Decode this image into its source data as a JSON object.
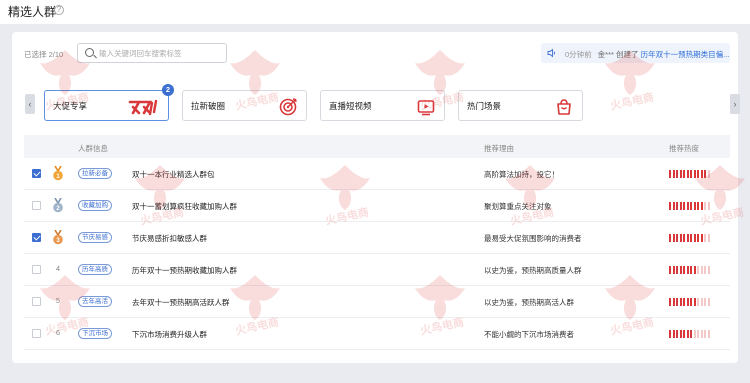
{
  "topbar": {
    "title": "精选人群",
    "help_icon": "help-circle-icon"
  },
  "toolbar": {
    "selected_label": "已选择",
    "selected_value": "2/10",
    "search_placeholder": "输入关键词回车搜索标签"
  },
  "notice": {
    "speaker_icon": "speaker-icon",
    "time": "0分钟前",
    "user_text": "金*** 创建了",
    "link_text": "历年双十一预热期类目偏..."
  },
  "tabs": [
    {
      "label": "大促专享",
      "icon": "double11-logo",
      "badge": "2",
      "active": true
    },
    {
      "label": "拉新破圈",
      "icon": "target-icon",
      "badge": "",
      "active": false
    },
    {
      "label": "直播短视频",
      "icon": "play-screen-icon",
      "badge": "",
      "active": false
    },
    {
      "label": "热门场景",
      "icon": "shopping-bag-icon",
      "badge": "",
      "active": false
    }
  ],
  "table": {
    "columns": {
      "info": "人群信息",
      "reason": "推荐理由",
      "heat": "推荐热度"
    },
    "rows": [
      {
        "checked": true,
        "rank": "1",
        "medal": "gold",
        "tag": "拉新必备",
        "name": "双十一本行业精选人群包",
        "reason": "高阶算法加持，投它！",
        "heat": 0.95
      },
      {
        "checked": false,
        "rank": "2",
        "medal": "silver",
        "tag": "收藏加购",
        "name": "双十一蓄划算疯狂收藏加购人群",
        "reason": "聚划算重点关注对象",
        "heat": 0.85
      },
      {
        "checked": true,
        "rank": "3",
        "medal": "bronze",
        "tag": "节庆易感",
        "name": "节庆易感折扣敏感人群",
        "reason": "最易受大促氛围影响的消费者",
        "heat": 0.8
      },
      {
        "checked": false,
        "rank": "4",
        "medal": "",
        "tag": "历年高质",
        "name": "历年双十一预热期收藏加购人群",
        "reason": "以史为鉴，预热期高质量人群",
        "heat": 0.7
      },
      {
        "checked": false,
        "rank": "5",
        "medal": "",
        "tag": "去年高活",
        "name": "去年双十一预热期高活跃人群",
        "reason": "以史为鉴，预热期高活人群",
        "heat": 0.65
      },
      {
        "checked": false,
        "rank": "6",
        "medal": "",
        "tag": "下沉市场",
        "name": "下沉市场消费升级人群",
        "reason": "不能小觑的下沉市场消费者",
        "heat": 0.6
      }
    ]
  },
  "watermark_text": "火鸟电商",
  "colors": {
    "accent": "#3d6fd1",
    "heat_on": "#d9383a",
    "heat_off": "#f1c9c9"
  }
}
